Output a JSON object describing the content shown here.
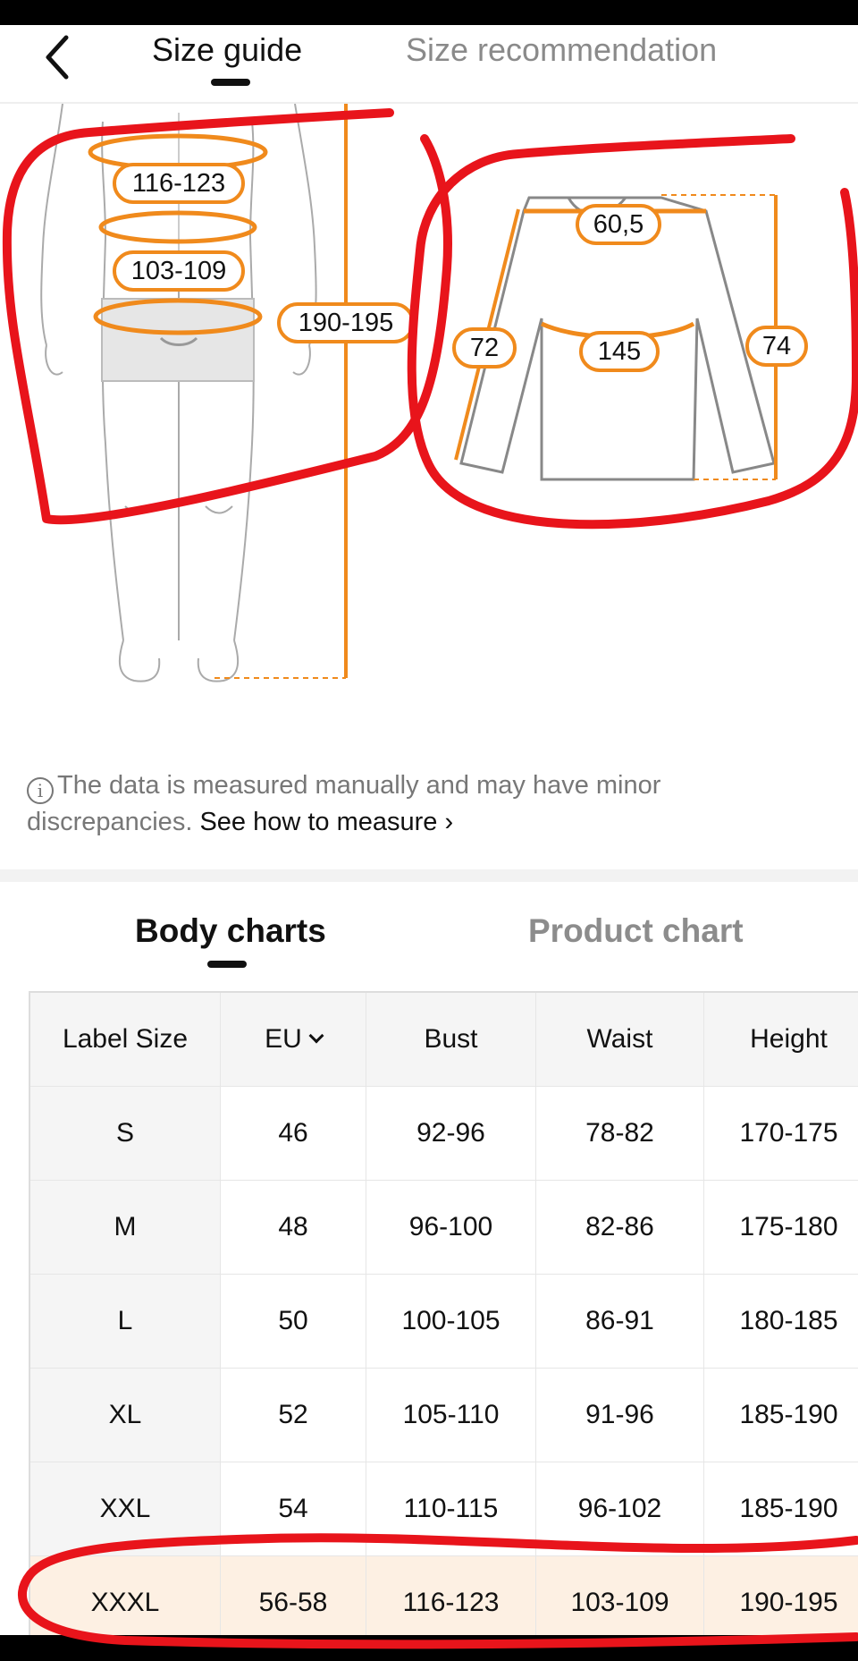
{
  "header": {
    "tab_size_guide": "Size guide",
    "tab_size_recommendation": "Size recommendation"
  },
  "body_figure": {
    "bust": "116-123",
    "waist": "103-109",
    "height": "190-195"
  },
  "garment_figure": {
    "shoulder": "60,5",
    "chest": "145",
    "sleeve": "72",
    "length": "74"
  },
  "note": {
    "text": "The data is measured manually and may have minor discrepancies.",
    "link": "See how to measure"
  },
  "chart_tabs": {
    "body": "Body charts",
    "product": "Product chart"
  },
  "table": {
    "headers": [
      "Label Size",
      "EU",
      "Bust",
      "Waist",
      "Height"
    ],
    "rows": [
      [
        "S",
        "46",
        "92-96",
        "78-82",
        "170-175"
      ],
      [
        "M",
        "48",
        "96-100",
        "82-86",
        "175-180"
      ],
      [
        "L",
        "50",
        "100-105",
        "86-91",
        "180-185"
      ],
      [
        "XL",
        "52",
        "105-110",
        "91-96",
        "185-190"
      ],
      [
        "XXL",
        "54",
        "110-115",
        "96-102",
        "185-190"
      ],
      [
        "XXXL",
        "56-58",
        "116-123",
        "103-109",
        "190-195"
      ]
    ],
    "highlighted_row": "XXXL"
  },
  "colors": {
    "accent_orange": "#f08a1c",
    "highlight_row": "#fdf0e3",
    "annotation_red": "#e8141b"
  }
}
